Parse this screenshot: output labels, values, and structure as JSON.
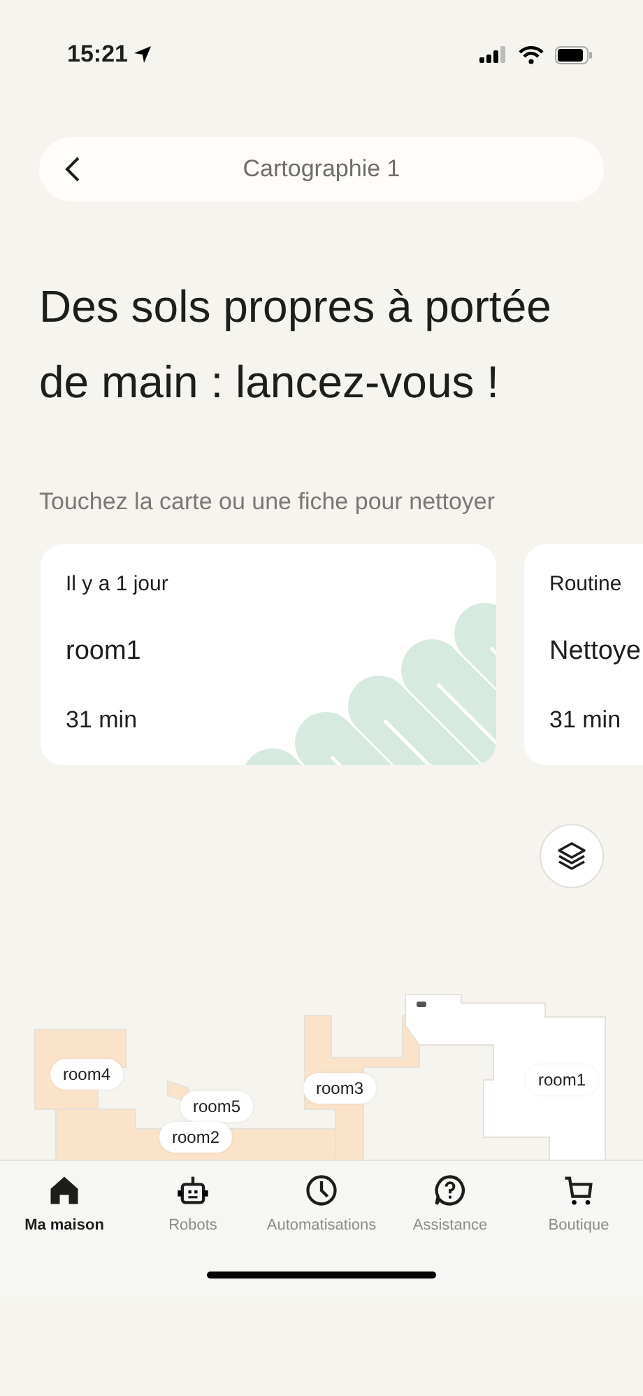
{
  "status_bar": {
    "time": "15:21"
  },
  "header": {
    "title": "Cartographie 1"
  },
  "heading": "Des sols propres à portée de main : lancez-vous !",
  "hint": "Touchez la carte ou une fiche pour nettoyer",
  "cards": [
    {
      "caption": "Il y a 1 jour",
      "title": "room1",
      "duration": "31 min"
    },
    {
      "caption": "Routine",
      "title": "Nettoye",
      "duration": "31 min"
    }
  ],
  "map": {
    "rooms": [
      {
        "name": "room4",
        "color": "#fbe3c9"
      },
      {
        "name": "room5",
        "color": "#fbe3c9"
      },
      {
        "name": "room2",
        "color": "#fbe3c9"
      },
      {
        "name": "room3",
        "color": "#fbe3c9"
      },
      {
        "name": "room1",
        "color": "#ffffff"
      }
    ]
  },
  "tabs": [
    {
      "label": "Ma maison",
      "selected": true
    },
    {
      "label": "Robots",
      "selected": false
    },
    {
      "label": "Automatisations",
      "selected": false
    },
    {
      "label": "Assistance",
      "selected": false
    },
    {
      "label": "Boutique",
      "selected": false
    }
  ]
}
